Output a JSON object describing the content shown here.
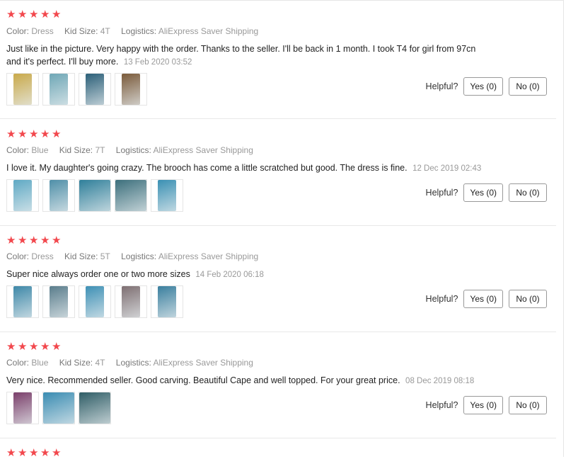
{
  "rating_star": "★",
  "labels": {
    "color": "Color:",
    "kid_size": "Kid Size:",
    "logistics": "Logistics:",
    "helpful": "Helpful?"
  },
  "reviews": [
    {
      "stars": 5,
      "color": "Dress",
      "kid_size": "4T",
      "logistics": "AliExpress Saver Shipping",
      "text": "Just like in the picture. Very happy with the order. Thanks to the seller. I'll be back in 1 month. I took T4 for girl from 97cn and it's perfect. I'll buy more.",
      "date": "13 Feb 2020 03:52",
      "yes": "Yes (0)",
      "no": "No (0)",
      "photos": [
        "#c9a94a",
        "#6fa7b6",
        "#2b5f78",
        "#7a5a3a"
      ]
    },
    {
      "stars": 5,
      "color": "Blue",
      "kid_size": "7T",
      "logistics": "AliExpress Saver Shipping",
      "text": "I love it. My daughter's going crazy. The brooch has come a little scratched but good. The dress is fine.",
      "date": "12 Dec 2019 02:43",
      "yes": "Yes (0)",
      "no": "No (0)",
      "photos": [
        "#5fa9c4",
        "#4f8fa8",
        "#2f7f9a",
        "#3c6f7c",
        "#3a90b3"
      ]
    },
    {
      "stars": 5,
      "color": "Dress",
      "kid_size": "5T",
      "logistics": "AliExpress Saver Shipping",
      "text": "Super nice always order one or two more sizes",
      "date": "14 Feb 2020 06:18",
      "yes": "Yes (0)",
      "no": "No (0)",
      "photos": [
        "#3e88a8",
        "#5a7d8c",
        "#3e90b5",
        "#7e6f72",
        "#3a7f9e"
      ]
    },
    {
      "stars": 5,
      "color": "Blue",
      "kid_size": "4T",
      "logistics": "AliExpress Saver Shipping",
      "text": "Very nice. Recommended seller. Good carving. Beautiful Cape and well topped. For your great price.",
      "date": "08 Dec 2019 08:18",
      "yes": "Yes (0)",
      "no": "No (0)",
      "photos": [
        "#7a3f6a",
        "#3a8cb2",
        "#2f5d66"
      ]
    },
    {
      "stars": 5
    }
  ]
}
